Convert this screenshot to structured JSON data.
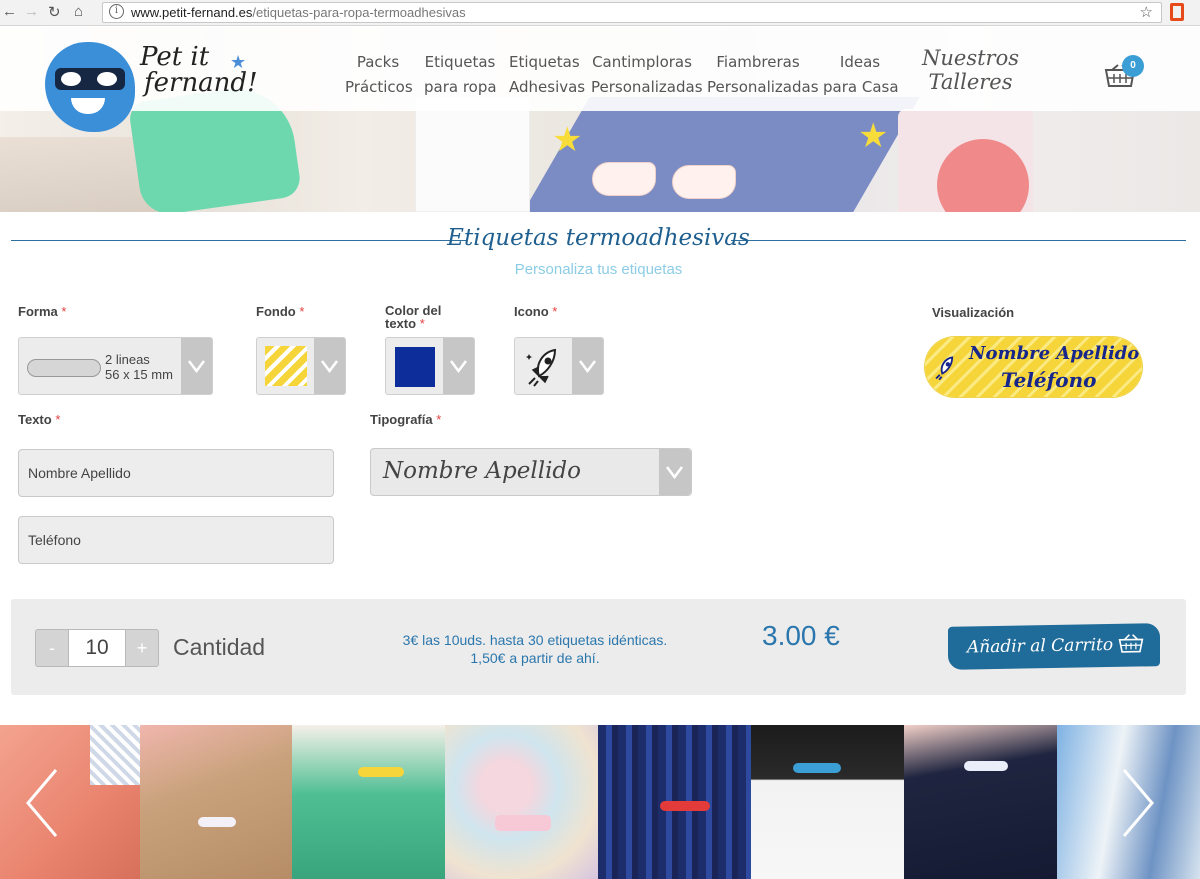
{
  "browser": {
    "url_host": "www.petit-fernand.es",
    "url_path": "/etiquetas-para-ropa-termoadhesivas"
  },
  "header": {
    "logo_line1": "Pet it",
    "logo_line2": "fernand!",
    "nav": [
      {
        "l1": "Packs",
        "l2": "Prácticos"
      },
      {
        "l1": "Etiquetas",
        "l2": "para ropa"
      },
      {
        "l1": "Etiquetas",
        "l2": "Adhesivas"
      },
      {
        "l1": "Cantimploras",
        "l2": "Personalizadas"
      },
      {
        "l1": "Fiambreras",
        "l2": "Personalizadas"
      },
      {
        "l1": "Ideas",
        "l2": "para Casa"
      }
    ],
    "talleres_l1": "Nuestros",
    "talleres_l2": "Talleres",
    "cart_count": "0"
  },
  "page": {
    "title": "Etiquetas termoadhesivas",
    "subtitle": "Personaliza tus etiquetas"
  },
  "form": {
    "forma_label": "Forma",
    "fondo_label": "Fondo",
    "color_label_l1": "Color del",
    "color_label_l2": "texto",
    "icono_label": "Icono",
    "visualizacion_label": "Visualización",
    "required_mark": "*",
    "forma_value_l1": "2 lineas",
    "forma_value_l2": "56 x 15 mm",
    "texto_label": "Texto",
    "tipografia_label": "Tipografía",
    "line1_value": "Nombre Apellido",
    "line2_value": "Teléfono",
    "tipografia_value": "Nombre Apellido",
    "text_color": "#0d2d9a",
    "fondo_color": "#f6d53a"
  },
  "preview": {
    "line1": "Nombre Apellido",
    "line2": "Teléfono"
  },
  "order": {
    "minus": "-",
    "plus": "+",
    "quantity": "10",
    "quantity_label": "Cantidad",
    "price_note_l1": "3€ las 10uds. hasta 30 etiquetas idénticas.",
    "price_note_l2": "1,50€ a partir de ahí.",
    "price": "3.00 €",
    "cart_button": "Añadir al Carrito"
  },
  "colors": {
    "accent": "#1f6b99",
    "price": "#2b77ad",
    "subtitle": "#8ccde6",
    "required": "#e23e3e"
  }
}
